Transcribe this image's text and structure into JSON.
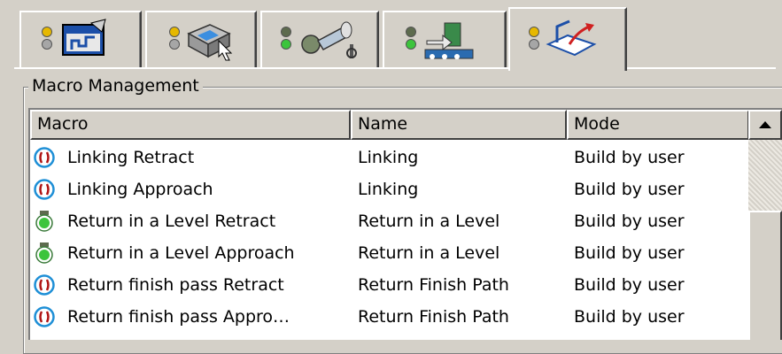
{
  "tabs": [
    {
      "icon": "cycle-parameters-icon",
      "status": "yellow"
    },
    {
      "icon": "tool-selection-icon",
      "status": "yellow"
    },
    {
      "icon": "tool-assembly-icon",
      "status": "green"
    },
    {
      "icon": "feeds-speeds-icon",
      "status": "green"
    },
    {
      "icon": "macro-motion-icon",
      "status": "yellow",
      "active": true
    }
  ],
  "group": {
    "legend": "Macro Management"
  },
  "table": {
    "columns": [
      "Macro",
      "Name",
      "Mode"
    ],
    "rows": [
      {
        "icon": "inactive-macro-icon",
        "macro": "Linking Retract",
        "name": "Linking",
        "mode": "Build by user"
      },
      {
        "icon": "inactive-macro-icon",
        "macro": "Linking Approach",
        "name": "Linking",
        "mode": "Build by user"
      },
      {
        "icon": "active-macro-icon",
        "macro": "Return in a Level Retract",
        "name": "Return in a Level",
        "mode": "Build by user"
      },
      {
        "icon": "active-macro-icon",
        "macro": "Return in a Level Approach",
        "name": "Return in a Level",
        "mode": "Build by user"
      },
      {
        "icon": "inactive-macro-icon",
        "macro": "Return finish pass Retract",
        "name": "Return Finish Path",
        "mode": "Build by user"
      },
      {
        "icon": "inactive-macro-icon",
        "macro": "Return finish pass Appro…",
        "name": "Return Finish Path",
        "mode": "Build by user"
      }
    ]
  },
  "colors": {
    "face": "#d4d0c8",
    "list_bg": "#ffffff",
    "active_green": "#3cc43c",
    "inactive_blue": "#1e8fd6",
    "inactive_red": "#b01515"
  }
}
